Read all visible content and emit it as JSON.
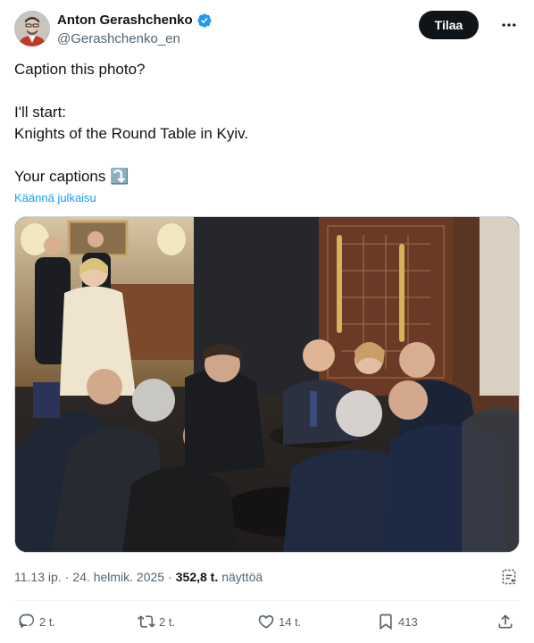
{
  "author": {
    "display_name": "Anton Gerashchenko",
    "handle": "@Gerashchenko_en",
    "avatar_icon": "profile-photo",
    "verified_icon": "verified-badge-icon",
    "verified_color": "#1d9bf0"
  },
  "subscribe_label": "Tilaa",
  "tweet": {
    "lines": [
      "Caption this photo?",
      "",
      "I'll start:",
      "Knights of the Round Table in Kyiv.",
      "",
      "Your captions ⤵️"
    ]
  },
  "translate_label": "Käännä julkaisu",
  "meta": {
    "time": "11.13 ip.",
    "sep1": "·",
    "date": "24. helmik. 2025",
    "sep2": "·",
    "views_count": "352,8 t.",
    "views_label": "näyttöä"
  },
  "actions": {
    "replies": "2 t.",
    "reposts": "2 t.",
    "likes": "14 t.",
    "bookmarks": "413"
  },
  "colors": {
    "text_primary": "#0f1419",
    "text_secondary": "#536471",
    "link": "#1d9bf0",
    "button_bg": "#0f1419"
  }
}
